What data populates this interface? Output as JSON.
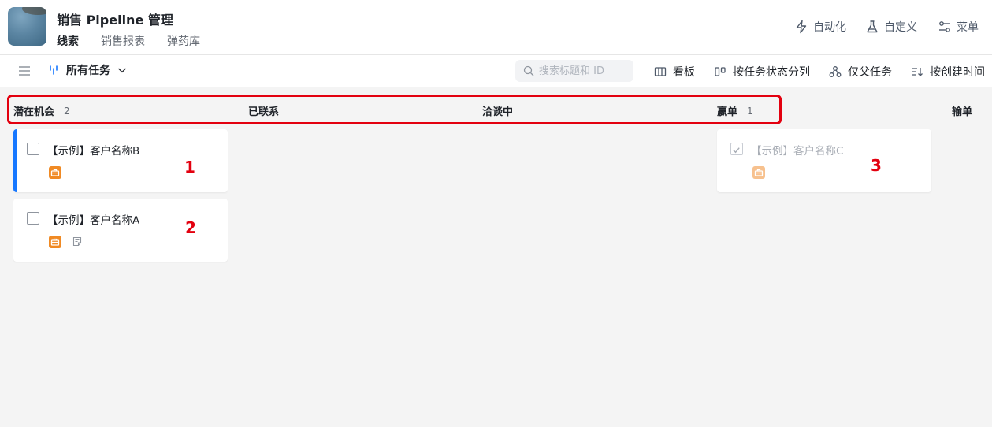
{
  "app": {
    "title": "销售 Pipeline 管理",
    "tabs": [
      {
        "label": "线索",
        "active": true
      },
      {
        "label": "销售报表",
        "active": false
      },
      {
        "label": "弹药库",
        "active": false
      }
    ],
    "actions": [
      {
        "label": "自动化",
        "icon": "lightning-icon"
      },
      {
        "label": "自定义",
        "icon": "flask-icon"
      },
      {
        "label": "菜单",
        "icon": "settings-sliders-icon"
      }
    ]
  },
  "toolbar": {
    "view_label": "所有任务",
    "search_placeholder": "搜索标题和 ID",
    "actions": [
      {
        "label": "看板",
        "icon": "board-icon"
      },
      {
        "label": "按任务状态分列",
        "icon": "columns-icon"
      },
      {
        "label": "仅父任务",
        "icon": "hierarchy-icon"
      },
      {
        "label": "按创建时间",
        "icon": "sort-icon"
      }
    ]
  },
  "columns": [
    {
      "name": "潜在机会",
      "count": "2"
    },
    {
      "name": "已联系",
      "count": ""
    },
    {
      "name": "洽谈中",
      "count": ""
    },
    {
      "name": "赢单",
      "count": "1"
    },
    {
      "name": "输单",
      "count": ""
    }
  ],
  "cards": [
    {
      "title": "【示例】客户名称B",
      "column": "潜在机会",
      "checked": false,
      "marker": "1"
    },
    {
      "title": "【示例】客户名称A",
      "column": "潜在机会",
      "checked": false,
      "marker": "2"
    },
    {
      "title": "【示例】客户名称C",
      "column": "赢单",
      "checked": true,
      "marker": "3"
    }
  ],
  "colors": {
    "accent": "#1677ff",
    "briefcase": "#f08a24",
    "highlight": "#e3000f"
  }
}
